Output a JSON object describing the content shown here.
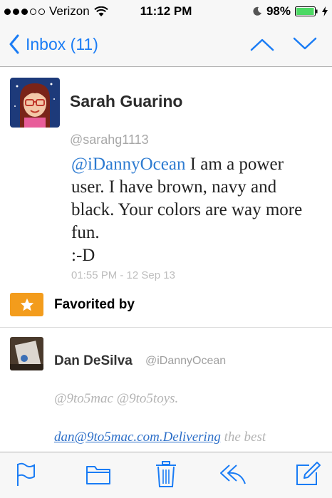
{
  "status_bar": {
    "carrier": "Verizon",
    "time": "11:12 PM",
    "battery_percent": "98%",
    "battery_level": 0.98,
    "signal_bars_filled": 3,
    "signal_bars_total": 5
  },
  "nav": {
    "back_label": "Inbox (11)",
    "icons": [
      "chevron-left-icon",
      "chevron-up-icon",
      "chevron-down-icon"
    ]
  },
  "tweet": {
    "author_name": "Sarah Guarino",
    "handle": "@sarahg1113",
    "mention": "@iDannyOcean",
    "body": " I am a power user. I have brown, navy and black. Your colors are way more fun.",
    "emote": ":-D",
    "timestamp": "01:55 PM - 12 Sep 13"
  },
  "favorited": {
    "label": "Favorited by",
    "icon": "star-icon"
  },
  "reply": {
    "author_name": "Dan DeSilva",
    "handle": "@iDannyOcean",
    "line1": "@9to5mac @9to5toys.",
    "link": "dan@9to5mac.com.Delivering",
    "line2_rest": " the best"
  },
  "toolbar": {
    "icons": [
      "flag-icon",
      "folder-icon",
      "trash-icon",
      "reply-icon",
      "compose-icon"
    ]
  },
  "colors": {
    "accent": "#1a7cf5",
    "mention": "#2d7bd1",
    "favorite": "#f39c1c",
    "battery": "#4cd964"
  }
}
